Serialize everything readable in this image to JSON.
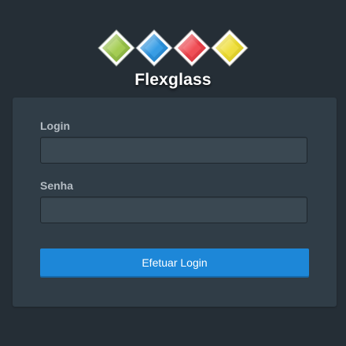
{
  "brand": {
    "name": "Flexglass",
    "logo_colors": [
      "#8bb83a",
      "#1c86d4",
      "#e4323b",
      "#e4d21f"
    ]
  },
  "form": {
    "login_label": "Login",
    "login_value": "",
    "password_label": "Senha",
    "password_value": "",
    "submit_label": "Efetuar Login"
  },
  "colors": {
    "background": "#252e36",
    "card": "#303d47",
    "field": "#3a4852",
    "accent": "#1d87d8"
  }
}
